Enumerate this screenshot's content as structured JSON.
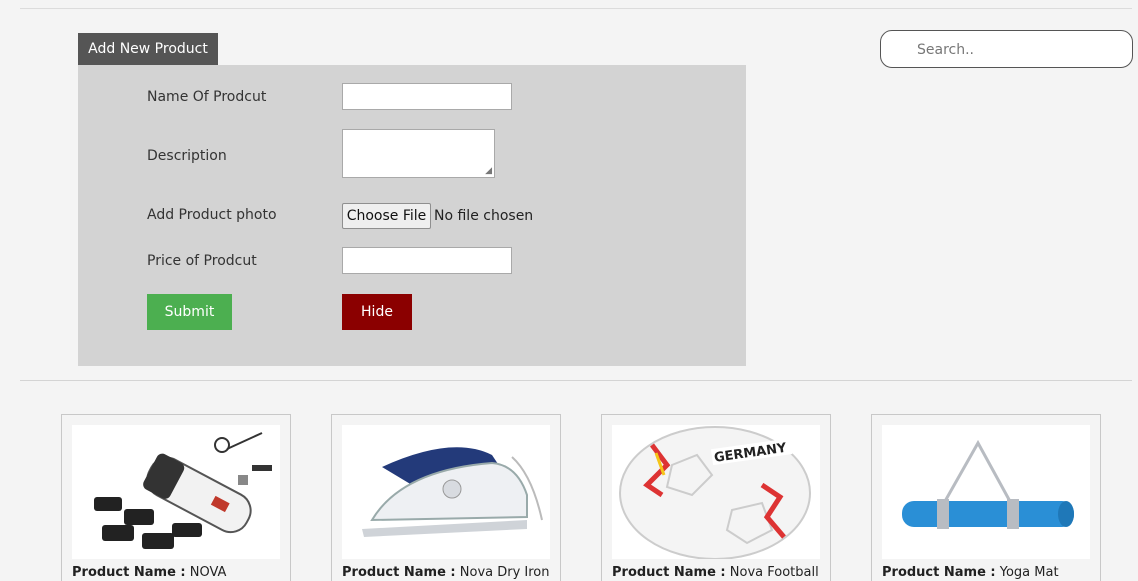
{
  "form": {
    "tab_label": "Add New Product",
    "name_label": "Name Of Prodcut",
    "description_label": "Description",
    "photo_label": "Add Product photo",
    "price_label": "Price of Prodcut",
    "file_button": "Choose File",
    "file_status": "No file chosen",
    "submit_label": "Submit",
    "hide_label": "Hide",
    "name_value": "",
    "description_value": "",
    "price_value": ""
  },
  "search": {
    "placeholder": "Search.."
  },
  "colors": {
    "tab": "#555555",
    "panel": "#d3d3d3",
    "submit": "#4caf50",
    "hide": "#8b0000",
    "mat": "#2a8fd6"
  },
  "products": [
    {
      "label": "Product Name :",
      "name": "NOVA",
      "image": "hair-clipper-image"
    },
    {
      "label": "Product Name :",
      "name": "Nova Dry Iron",
      "image": "dry-iron-image"
    },
    {
      "label": "Product Name :",
      "name": "Nova Football",
      "image": "football-image",
      "ball_print": "GERMANY"
    },
    {
      "label": "Product Name :",
      "name": "Yoga Mat",
      "image": "yoga-mat-image"
    }
  ]
}
